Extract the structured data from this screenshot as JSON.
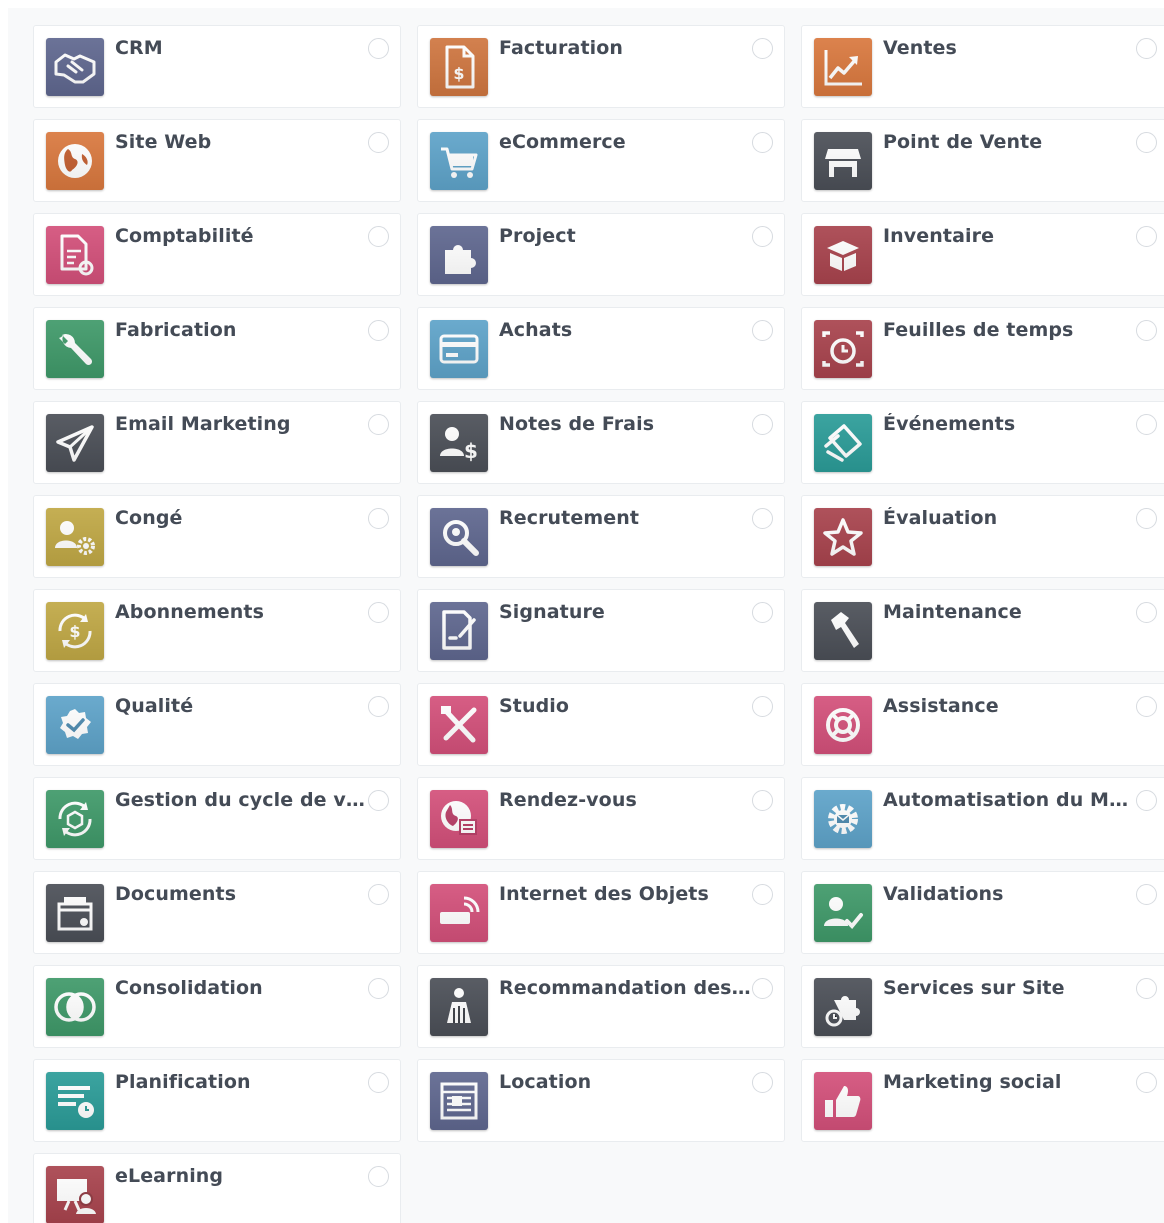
{
  "apps": [
    {
      "name": "CRM",
      "icon": "handshake-icon",
      "color": "#5f678f"
    },
    {
      "name": "Facturation",
      "icon": "invoice-icon",
      "color": "#cf7640"
    },
    {
      "name": "Ventes",
      "icon": "chart-up-icon",
      "color": "#d9783e"
    },
    {
      "name": "Site Web",
      "icon": "globe-icon",
      "color": "#d9783e"
    },
    {
      "name": "eCommerce",
      "icon": "cart-icon",
      "color": "#5ea3c9"
    },
    {
      "name": "Point de Vente",
      "icon": "store-icon",
      "color": "#4b4f57"
    },
    {
      "name": "Comptabilité",
      "icon": "accounting-doc-icon",
      "color": "#d3507a"
    },
    {
      "name": "Project",
      "icon": "puzzle-icon",
      "color": "#5f678f"
    },
    {
      "name": "Inventaire",
      "icon": "box-icon",
      "color": "#a8434d"
    },
    {
      "name": "Fabrication",
      "icon": "wrench-icon",
      "color": "#3f9969"
    },
    {
      "name": "Achats",
      "icon": "credit-card-icon",
      "color": "#5ea3c9"
    },
    {
      "name": "Feuilles de temps",
      "icon": "stopwatch-icon",
      "color": "#a8434d"
    },
    {
      "name": "Email Marketing",
      "icon": "paper-plane-icon",
      "color": "#4b4f57"
    },
    {
      "name": "Notes de Frais",
      "icon": "user-dollar-icon",
      "color": "#4b4f57"
    },
    {
      "name": "Événements",
      "icon": "tickets-icon",
      "color": "#2b9c98"
    },
    {
      "name": "Congé",
      "icon": "user-gear-icon",
      "color": "#c0a845"
    },
    {
      "name": "Recrutement",
      "icon": "magnifier-icon",
      "color": "#5f678f"
    },
    {
      "name": "Évaluation",
      "icon": "star-icon",
      "color": "#a8434d"
    },
    {
      "name": "Abonnements",
      "icon": "recurring-dollar-icon",
      "color": "#c0a845"
    },
    {
      "name": "Signature",
      "icon": "signature-icon",
      "color": "#5f678f"
    },
    {
      "name": "Maintenance",
      "icon": "hammer-icon",
      "color": "#4b4f57"
    },
    {
      "name": "Qualité",
      "icon": "quality-badge-icon",
      "color": "#5ea3c9"
    },
    {
      "name": "Studio",
      "icon": "tools-icon",
      "color": "#d3507a"
    },
    {
      "name": "Assistance",
      "icon": "lifebuoy-icon",
      "color": "#d3507a"
    },
    {
      "name": "Gestion du cycle de vie ...",
      "icon": "cycle-cube-icon",
      "color": "#3f9969"
    },
    {
      "name": "Rendez-vous",
      "icon": "calendar-globe-icon",
      "color": "#d3507a"
    },
    {
      "name": "Automatisation du Mar...",
      "icon": "gear-mail-icon",
      "color": "#5ea3c9"
    },
    {
      "name": "Documents",
      "icon": "document-tray-icon",
      "color": "#4b4f57"
    },
    {
      "name": "Internet des Objets",
      "icon": "iot-icon",
      "color": "#d3507a"
    },
    {
      "name": "Validations",
      "icon": "user-check-icon",
      "color": "#3f9969"
    },
    {
      "name": "Consolidation",
      "icon": "overlap-circles-icon",
      "color": "#3f9969"
    },
    {
      "name": "Recommandation des ...",
      "icon": "referral-person-icon",
      "color": "#4b4f57"
    },
    {
      "name": "Services sur Site",
      "icon": "field-service-icon",
      "color": "#4b4f57"
    },
    {
      "name": "Planification",
      "icon": "planning-icon",
      "color": "#2b9c98"
    },
    {
      "name": "Location",
      "icon": "rental-calendar-icon",
      "color": "#5f678f"
    },
    {
      "name": "Marketing social",
      "icon": "thumbs-up-icon",
      "color": "#d3507a"
    },
    {
      "name": "eLearning",
      "icon": "elearning-icon",
      "color": "#a8434d"
    }
  ]
}
